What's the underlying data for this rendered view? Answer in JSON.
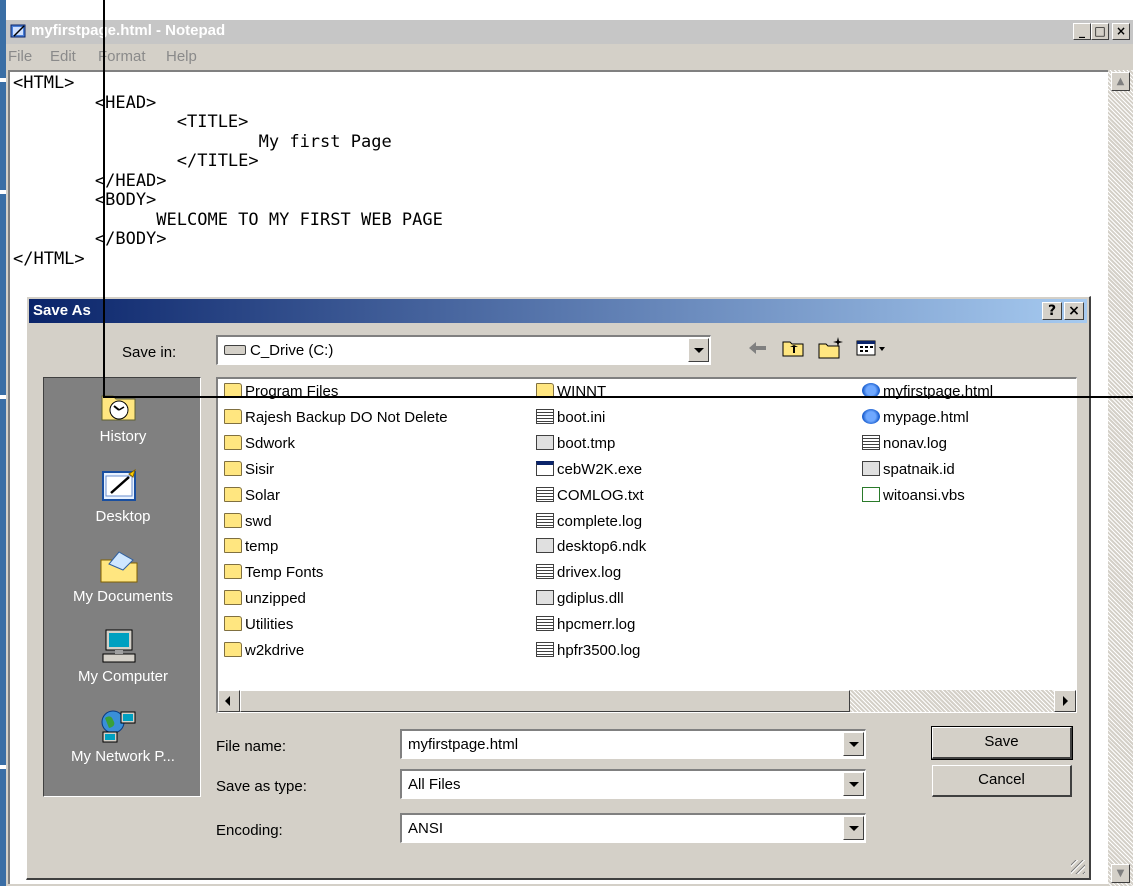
{
  "notepad": {
    "title": "myfirstpage.html - Notepad",
    "menu": [
      "File",
      "Edit",
      "Format",
      "Help"
    ],
    "code_lines": [
      "<HTML>",
      "        <HEAD>",
      "                <TITLE>",
      "                        My first Page",
      "                </TITLE>",
      "        </HEAD>",
      "        <BODY>",
      "              WELCOME TO MY FIRST WEB PAGE",
      "        </BODY>",
      "</HTML>"
    ],
    "window_buttons": {
      "minimize": "_",
      "maximize": "□",
      "close": "×"
    }
  },
  "dialog": {
    "title": "Save As",
    "help_btn": "?",
    "close_btn": "×",
    "save_in_label": "Save in:",
    "save_in_value": "C_Drive (C:)",
    "places": [
      "History",
      "Desktop",
      "My Documents",
      "My Computer",
      "My Network P..."
    ],
    "files": {
      "col1": [
        {
          "name": "Program Files",
          "icon": "folder-icon"
        },
        {
          "name": "Rajesh Backup DO Not Delete",
          "icon": "shared-folder-icon"
        },
        {
          "name": "Sdwork",
          "icon": "folder-icon"
        },
        {
          "name": "Sisir",
          "icon": "folder-icon"
        },
        {
          "name": "Solar",
          "icon": "folder-icon"
        },
        {
          "name": "swd",
          "icon": "folder-icon"
        },
        {
          "name": "temp",
          "icon": "folder-icon"
        },
        {
          "name": "Temp Fonts",
          "icon": "folder-icon"
        },
        {
          "name": "unzipped",
          "icon": "folder-icon"
        },
        {
          "name": "Utilities",
          "icon": "folder-icon"
        },
        {
          "name": "w2kdrive",
          "icon": "folder-icon"
        }
      ],
      "col2": [
        {
          "name": "WINNT",
          "icon": "folder-icon"
        },
        {
          "name": "boot.ini",
          "icon": "ini-file-icon"
        },
        {
          "name": "boot.tmp",
          "icon": "tmp-file-icon"
        },
        {
          "name": "cebW2K.exe",
          "icon": "exe-file-icon"
        },
        {
          "name": "COMLOG.txt",
          "icon": "text-file-icon"
        },
        {
          "name": "complete.log",
          "icon": "text-file-icon"
        },
        {
          "name": "desktop6.ndk",
          "icon": "tmp-file-icon"
        },
        {
          "name": "drivex.log",
          "icon": "text-file-icon"
        },
        {
          "name": "gdiplus.dll",
          "icon": "dll-file-icon"
        },
        {
          "name": "hpcmerr.log",
          "icon": "text-file-icon"
        },
        {
          "name": "hpfr3500.log",
          "icon": "text-file-icon"
        }
      ],
      "col3": [
        {
          "name": "myfirstpage.html",
          "icon": "ie-html-icon"
        },
        {
          "name": "mypage.html",
          "icon": "ie-html-icon"
        },
        {
          "name": "nonav.log",
          "icon": "text-file-icon"
        },
        {
          "name": "spatnaik.id",
          "icon": "tmp-file-icon"
        },
        {
          "name": "witoansi.vbs",
          "icon": "vbs-file-icon"
        }
      ]
    },
    "file_name_label": "File name:",
    "file_name_value": "myfirstpage.html",
    "save_as_type_label": "Save as type:",
    "save_as_type_value": "All Files",
    "encoding_label": "Encoding:",
    "encoding_value": "ANSI",
    "save_button": "Save",
    "cancel_button": "Cancel"
  }
}
